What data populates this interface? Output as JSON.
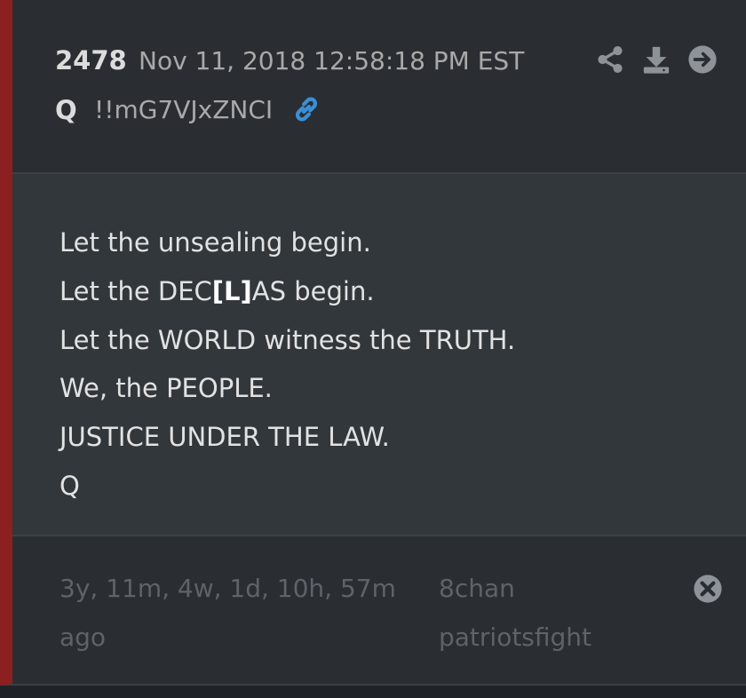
{
  "post": {
    "number": "2478",
    "timestamp": "Nov 11, 2018 12:58:18 PM EST",
    "author": "Q",
    "tripcode": "!!mG7VJxZNCI",
    "lines": [
      "Let the unsealing begin.",
      "Let the DEC",
      "[L]",
      "AS begin.",
      "Let the WORLD witness the TRUTH.",
      "We, the PEOPLE.",
      "JUSTICE UNDER THE LAW.",
      "Q"
    ]
  },
  "footer": {
    "age_line1": "3y, 11m, 4w, 1d, 10h, 57m",
    "age_line2": "ago",
    "source_line1": "8chan",
    "source_line2": "patriotsfight"
  },
  "icons": {
    "toolbar": [
      "share-icon",
      "download-icon",
      "goto-icon"
    ],
    "link": "link-icon",
    "close": "close-icon"
  },
  "colors": {
    "accent_bar": "#8c1f1f",
    "link_blue": "#3b8fd6",
    "icon_grey": "#8d9398"
  }
}
